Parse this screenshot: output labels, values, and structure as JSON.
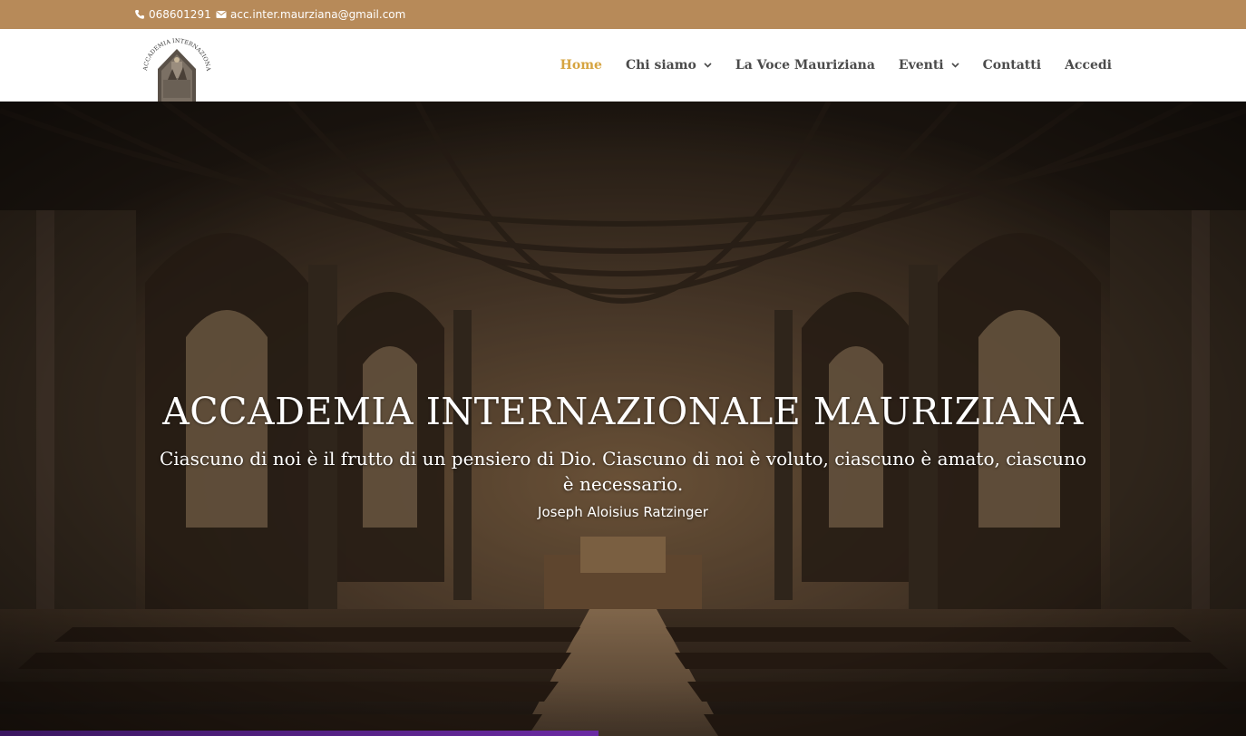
{
  "topbar": {
    "phone": "068601291",
    "email": "acc.inter.maurziana@gmail.com",
    "phone_icon": "phone-icon",
    "email_icon": "envelope-icon",
    "background": "#b78a59"
  },
  "header": {
    "logo_text": "ACCADEMIA INTERNAZIONALE MAURIZIANA",
    "nav": [
      {
        "label": "Home",
        "active": true
      },
      {
        "label": "Chi siamo",
        "dropdown": true
      },
      {
        "label": "La Voce Mauriziana"
      },
      {
        "label": "Eventi",
        "dropdown": true
      },
      {
        "label": "Contatti"
      },
      {
        "label": "Accedi"
      }
    ],
    "active_color": "#d6a440"
  },
  "hero": {
    "title": "ACCADEMIA INTERNAZIONALE MAURIZIANA",
    "quote": "Ciascuno di noi è il frutto di un pensiero di Dio. Ciascuno di noi è voluto, ciascuno è amato, ciascuno è necessario.",
    "author": "Joseph Aloisius Ratzinger"
  }
}
